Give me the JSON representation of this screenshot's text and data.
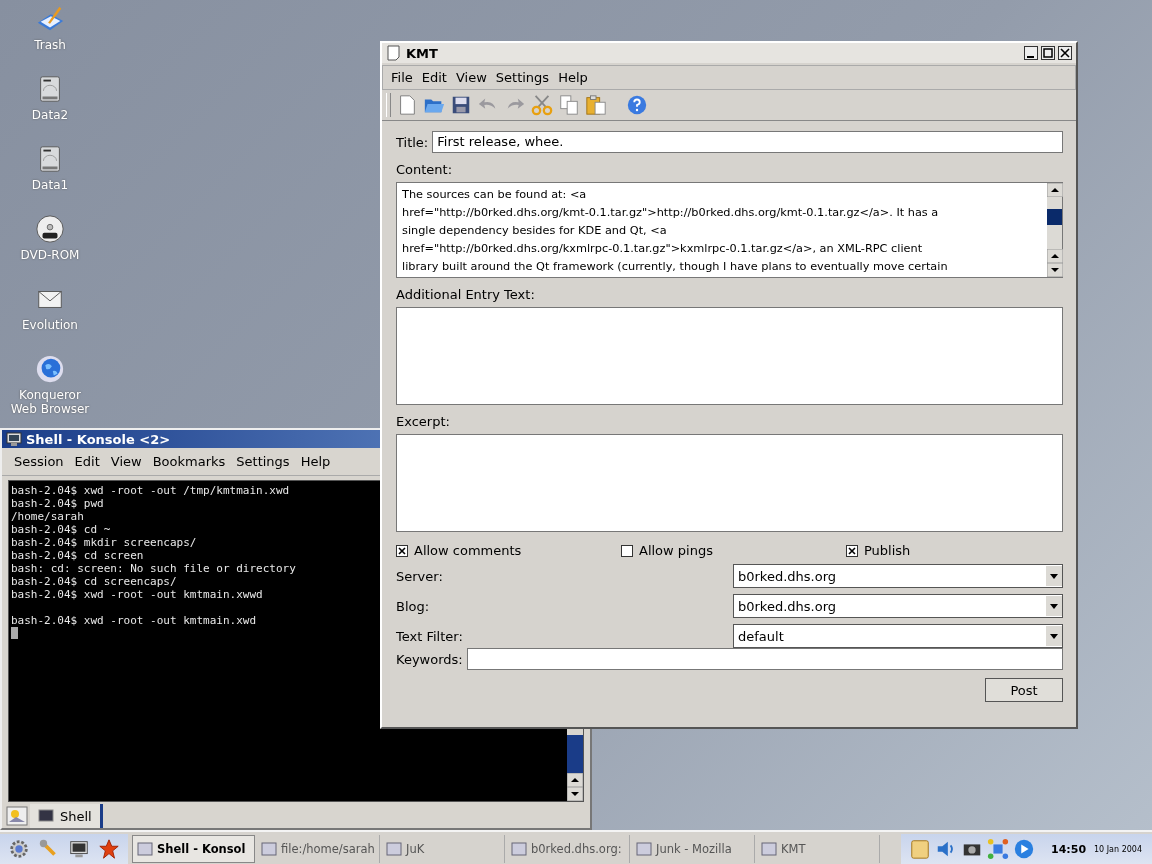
{
  "desktop_icons": [
    {
      "label": "Trash",
      "kind": "trash"
    },
    {
      "label": "Data2",
      "kind": "drive"
    },
    {
      "label": "Data1",
      "kind": "drive"
    },
    {
      "label": "DVD-ROM",
      "kind": "dvd"
    },
    {
      "label": "Evolution",
      "kind": "mail"
    },
    {
      "label": "Konqueror Web Browser",
      "kind": "globe"
    }
  ],
  "konsole": {
    "title": "Shell - Konsole <2>",
    "menu": [
      "Session",
      "Edit",
      "View",
      "Bookmarks",
      "Settings",
      "Help"
    ],
    "line_blocks": [
      [
        "bash-2.04$ xwd -root -out /tmp/kmtmain.xwd",
        "bash-2.04$ pwd",
        "/home/sarah",
        "bash-2.04$ cd ~",
        "bash-2.04$ mkdir screencaps/",
        "bash-2.04$ cd screen",
        "bash: cd: screen: No such file or directory",
        "bash-2.04$ cd screencaps/",
        "bash-2.04$ xwd -root -out kmtmain.xwwd"
      ],
      [
        "bash-2.04$ xwd -root -out kmtmain.xwd"
      ]
    ],
    "tabs": [
      {
        "label": "Shell",
        "selected": true
      }
    ]
  },
  "kmt": {
    "title": "KMT",
    "menu": [
      "File",
      "Edit",
      "View",
      "Settings",
      "Help"
    ],
    "toolbar": [
      {
        "kind": "new",
        "disabled": false
      },
      {
        "kind": "open",
        "disabled": false
      },
      {
        "kind": "save",
        "disabled": false
      },
      {
        "kind": "undo",
        "disabled": true
      },
      {
        "kind": "redo",
        "disabled": true
      },
      {
        "kind": "cut",
        "disabled": false
      },
      {
        "kind": "copy",
        "disabled": false
      },
      {
        "kind": "paste",
        "disabled": false
      },
      {
        "kind": "help",
        "disabled": false
      }
    ],
    "title_label": "Title:",
    "title_value": "First release, whee.",
    "content_label": "Content:",
    "content_lines": [
      "The sources can be found at: <a",
      "href=\"http://b0rked.dhs.org/kmt-0.1.tar.gz\">http://b0rked.dhs.org/kmt-0.1.tar.gz</a>. It has a",
      "single dependency besides for KDE and Qt, <a",
      "href=\"http://b0rked.dhs.org/kxmlrpc-0.1.tar.gz\">kxmlrpc-0.1.tar.gz</a>, an XML-RPC client",
      "library built around the Qt framework (currently, though I have plans to eventually move certain"
    ],
    "additional_label": "Additional Entry Text:",
    "excerpt_label": "Excerpt:",
    "checkboxes": [
      {
        "label": "Allow comments",
        "checked": true
      },
      {
        "label": "Allow pings",
        "checked": false
      },
      {
        "label": "Publish",
        "checked": true
      }
    ],
    "combos": [
      {
        "label": "Server:",
        "value": "b0rked.dhs.org"
      },
      {
        "label": "Blog:",
        "value": "b0rked.dhs.org"
      },
      {
        "label": "Text Filter:",
        "value": "default"
      }
    ],
    "keywords_label": "Keywords:",
    "post_button": "Post"
  },
  "taskbar": {
    "tasks": [
      {
        "label": "Shell - Konsol",
        "selected": true
      },
      {
        "label": "file:/home/sarah",
        "selected": false
      },
      {
        "label": "JuK",
        "selected": false
      },
      {
        "label": "b0rked.dhs.org:",
        "selected": false
      },
      {
        "label": "Junk - Mozilla",
        "selected": false
      },
      {
        "label": "KMT",
        "selected": false
      }
    ],
    "time": "14:50",
    "date": "10 Jan 2004"
  }
}
